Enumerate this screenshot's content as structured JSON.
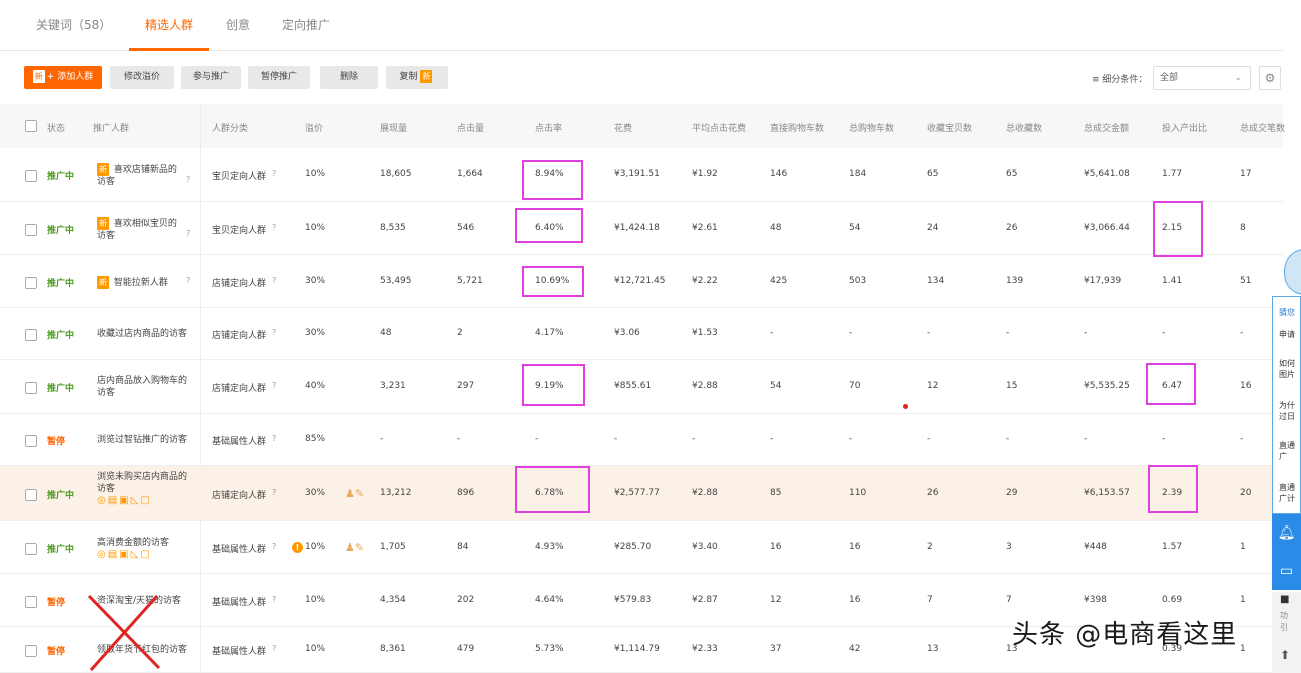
{
  "tabs": [
    {
      "label": "关键词（58）"
    },
    {
      "label": "精选人群"
    },
    {
      "label": "创意"
    },
    {
      "label": "定向推广"
    }
  ],
  "toolbar": {
    "new_badge": "新",
    "add_label": "+ 添加人群",
    "modify_label": "修改溢价",
    "join_label": "参与推广",
    "pause_label": "暂停推广",
    "delete_label": "删除",
    "copy_label": "复制",
    "filter_label": "细分条件：",
    "filter_value": "全部"
  },
  "columns": [
    "状态",
    "推广人群",
    "人群分类",
    "溢价",
    "展现量",
    "点击量",
    "点击率",
    "花费",
    "平均点击花费",
    "直接购物车数",
    "总购物车数",
    "收藏宝贝数",
    "总收藏数",
    "总成交金额",
    "投入产出比",
    "总成交笔数"
  ],
  "rows": [
    {
      "status": "推广中",
      "name1": "喜欢店铺新品的",
      "name2": "访客",
      "badge": "新",
      "category": "宝贝定向人群",
      "premium": "10%",
      "impressions": "18,605",
      "clicks": "1,664",
      "ctr": "8.94%",
      "cost": "¥3,191.51",
      "avg_cpc": "¥1.92",
      "direct_cart": "146",
      "total_cart": "184",
      "fav_items": "65",
      "total_fav": "65",
      "gmv": "¥5,641.08",
      "roi": "1.77",
      "orders": "17"
    },
    {
      "status": "推广中",
      "name1": "喜欢相似宝贝的",
      "name2": "访客",
      "badge": "新",
      "category": "宝贝定向人群",
      "premium": "10%",
      "impressions": "8,535",
      "clicks": "546",
      "ctr": "6.40%",
      "cost": "¥1,424.18",
      "avg_cpc": "¥2.61",
      "direct_cart": "48",
      "total_cart": "54",
      "fav_items": "24",
      "total_fav": "26",
      "gmv": "¥3,066.44",
      "roi": "2.15",
      "orders": "8"
    },
    {
      "status": "推广中",
      "name1": "智能拉新人群",
      "name2": "",
      "badge": "新",
      "category": "店铺定向人群",
      "premium": "30%",
      "impressions": "53,495",
      "clicks": "5,721",
      "ctr": "10.69%",
      "cost": "¥12,721.45",
      "avg_cpc": "¥2.22",
      "direct_cart": "425",
      "total_cart": "503",
      "fav_items": "134",
      "total_fav": "139",
      "gmv": "¥17,939",
      "roi": "1.41",
      "orders": "51"
    },
    {
      "status": "推广中",
      "name1": "收藏过店内商品的访客",
      "name2": "",
      "badge": "",
      "category": "店铺定向人群",
      "premium": "30%",
      "impressions": "48",
      "clicks": "2",
      "ctr": "4.17%",
      "cost": "¥3.06",
      "avg_cpc": "¥1.53",
      "direct_cart": "-",
      "total_cart": "-",
      "fav_items": "-",
      "total_fav": "-",
      "gmv": "-",
      "roi": "-",
      "orders": "-"
    },
    {
      "status": "推广中",
      "name1": "店内商品放入购物车的",
      "name2": "访客",
      "badge": "",
      "category": "店铺定向人群",
      "premium": "40%",
      "impressions": "3,231",
      "clicks": "297",
      "ctr": "9.19%",
      "cost": "¥855.61",
      "avg_cpc": "¥2.88",
      "direct_cart": "54",
      "total_cart": "70",
      "fav_items": "12",
      "total_fav": "15",
      "gmv": "¥5,535.25",
      "roi": "6.47",
      "orders": "16"
    },
    {
      "status": "暂停",
      "name1": "浏览过智钻推广的访客",
      "name2": "",
      "badge": "",
      "category": "基础属性人群",
      "premium": "85%",
      "impressions": "-",
      "clicks": "-",
      "ctr": "-",
      "cost": "-",
      "avg_cpc": "-",
      "direct_cart": "-",
      "total_cart": "-",
      "fav_items": "-",
      "total_fav": "-",
      "gmv": "-",
      "roi": "-",
      "orders": "-"
    },
    {
      "status": "推广中",
      "name1": "浏览未购买店内商品的",
      "name2": "访客",
      "badge": "",
      "category": "店铺定向人群",
      "premium": "30%",
      "impressions": "13,212",
      "clicks": "896",
      "ctr": "6.78%",
      "cost": "¥2,577.77",
      "avg_cpc": "¥2.88",
      "direct_cart": "85",
      "total_cart": "110",
      "fav_items": "26",
      "total_fav": "29",
      "gmv": "¥6,153.57",
      "roi": "2.39",
      "orders": "20"
    },
    {
      "status": "推广中",
      "name1": "高消费金额的访客",
      "name2": "",
      "badge": "",
      "category": "基础属性人群",
      "premium": "10%",
      "impressions": "1,705",
      "clicks": "84",
      "ctr": "4.93%",
      "cost": "¥285.70",
      "avg_cpc": "¥3.40",
      "direct_cart": "16",
      "total_cart": "16",
      "fav_items": "2",
      "total_fav": "3",
      "gmv": "¥448",
      "roi": "1.57",
      "orders": "1"
    },
    {
      "status": "暂停",
      "name1": "资深淘宝/天猫的访客",
      "name2": "",
      "badge": "",
      "category": "基础属性人群",
      "premium": "10%",
      "impressions": "4,354",
      "clicks": "202",
      "ctr": "4.64%",
      "cost": "¥579.83",
      "avg_cpc": "¥2.87",
      "direct_cart": "12",
      "total_cart": "16",
      "fav_items": "7",
      "total_fav": "7",
      "gmv": "¥398",
      "roi": "0.69",
      "orders": "1"
    },
    {
      "status": "暂停",
      "name1": "领取年货节红包的访客",
      "name2": "",
      "badge": "",
      "category": "基础属性人群",
      "premium": "10%",
      "impressions": "8,361",
      "clicks": "479",
      "ctr": "5.73%",
      "cost": "¥1,114.79",
      "avg_cpc": "¥2.33",
      "direct_cart": "37",
      "total_cart": "42",
      "fav_items": "13",
      "total_fav": "13",
      "gmv": "",
      "roi": "0.39",
      "orders": "1"
    }
  ],
  "side_panel": {
    "lines": [
      "猜您",
      "申请",
      "如何",
      "图片",
      "为什",
      "过日",
      "直通",
      "广",
      "直通",
      "广计"
    ],
    "bottom_lines": [
      "功",
      "引"
    ]
  },
  "watermark": "头条 @电商看这里",
  "colors": {
    "accent": "#ff6600",
    "status_active": "#4a9b1e",
    "status_paused": "#ff6600",
    "highlight_box": "#e040e0",
    "row_highlight": "#fbf1e6"
  }
}
